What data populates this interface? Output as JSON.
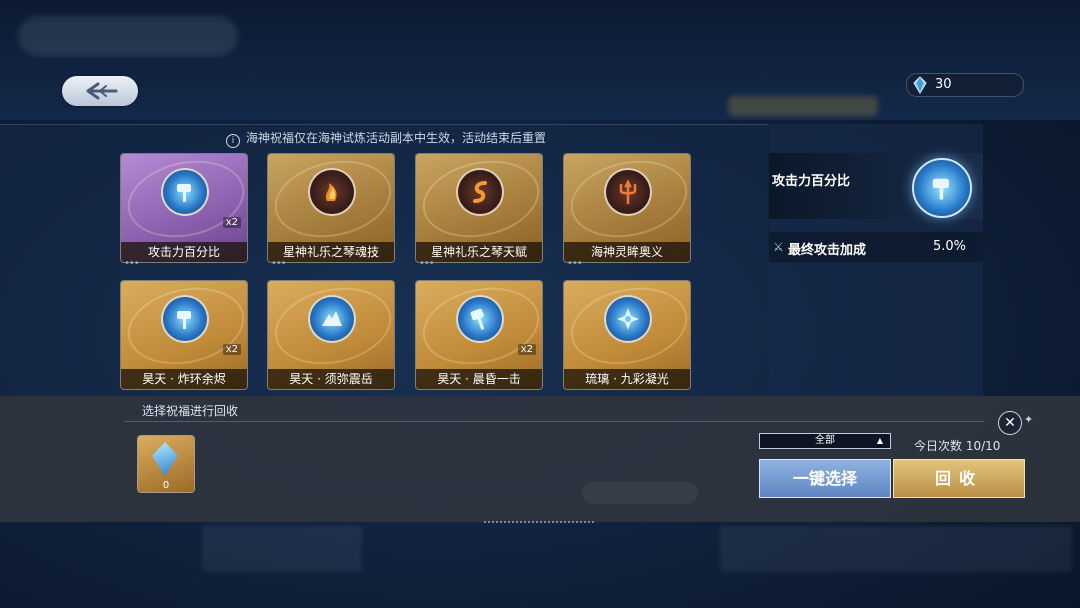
{
  "header": {
    "back_icon": "back-arrow-icon",
    "currency": {
      "icon": "crystal-icon",
      "value": "30"
    }
  },
  "notice": {
    "icon": "info-icon",
    "text": "海神祝福仅在海神试炼活动副本中生效，活动结束后重置"
  },
  "blessings": [
    {
      "name": "攻击力百分比",
      "count": "x2",
      "style": "purple",
      "icon": "hammer-orb-icon"
    },
    {
      "name": "星神礼乐之琴魂技",
      "count": "",
      "style": "gold",
      "icon": "flame-lyre-icon"
    },
    {
      "name": "星神礼乐之琴天赋",
      "count": "",
      "style": "gold",
      "icon": "flame-s-icon"
    },
    {
      "name": "海神灵眸奥义",
      "count": "",
      "style": "gold",
      "icon": "trident-icon"
    },
    {
      "name": "昊天 · 炸环余烬",
      "count": "x2",
      "style": "bright",
      "icon": "hammer-orb-icon"
    },
    {
      "name": "昊天 · 须弥震岳",
      "count": "",
      "style": "bright",
      "icon": "mountain-icon"
    },
    {
      "name": "昊天 · 晨昏一击",
      "count": "x2",
      "style": "bright",
      "icon": "hammer-icon"
    },
    {
      "name": "琉璃 · 九彩凝光",
      "count": "",
      "style": "bright",
      "icon": "glass-flower-icon"
    }
  ],
  "detail": {
    "title": "攻击力百分比",
    "icon": "hammer-orb-icon",
    "stat_icon": "sword-icon",
    "stat_label": "最终攻击加成",
    "stat_value": "5.0%"
  },
  "recycle": {
    "label": "选择祝福进行回收",
    "close_icon": "close-icon",
    "item": {
      "icon": "blue-crystal-icon",
      "count": "0"
    },
    "filter": {
      "value": "全部",
      "caret_icon": "caret-up-icon"
    },
    "today_count": "今日次数 10/10",
    "select_all_label": "一键选择",
    "recycle_label": "回收"
  },
  "colors": {
    "gold": "#c9a561",
    "purple": "#8a5fae",
    "blue_button": "#6f95cc",
    "gold_button": "#d1ad63"
  }
}
